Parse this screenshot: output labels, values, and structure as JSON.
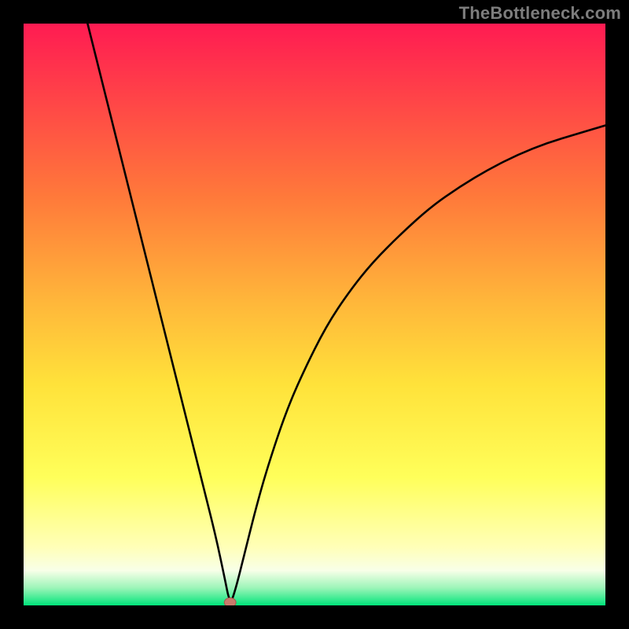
{
  "watermark": "TheBottleneck.com",
  "colors": {
    "frame": "#000000",
    "curve": "#000000",
    "marker_fill": "#c97a6c",
    "marker_stroke": "#a65b4e",
    "gradient": {
      "top": "#ff1b52",
      "mid1": "#ff7a3a",
      "mid2": "#ffb73a",
      "mid3": "#ffe23a",
      "yel": "#ffff5a",
      "pale": "#ffffb8",
      "white": "#f8ffe8",
      "mint": "#9cf5b8",
      "green": "#00e47a"
    }
  },
  "chart_data": {
    "type": "line",
    "title": "",
    "xlabel": "",
    "ylabel": "",
    "xlim": [
      0,
      100
    ],
    "ylim": [
      0,
      100
    ],
    "minimum": {
      "x": 35.5,
      "y": 0
    },
    "series": [
      {
        "name": "bottleneck-curve",
        "x": [
          11,
          13,
          15,
          17,
          19,
          21,
          23,
          25,
          27,
          29,
          31,
          33,
          34.5,
          35.5,
          36.5,
          38,
          40,
          42,
          45,
          48,
          52,
          56,
          60,
          65,
          70,
          75,
          80,
          85,
          90,
          95,
          100
        ],
        "values": [
          100,
          92,
          84,
          76,
          68,
          60,
          52,
          44,
          36,
          28,
          20,
          12,
          5,
          0,
          3,
          9,
          17,
          24,
          33,
          40,
          48,
          54,
          59,
          64,
          68.5,
          72,
          75,
          77.5,
          79.5,
          81,
          82.5
        ]
      }
    ],
    "marker": {
      "x": 35.5,
      "y": 0.5,
      "rx": 1.0,
      "ry": 0.8
    }
  }
}
